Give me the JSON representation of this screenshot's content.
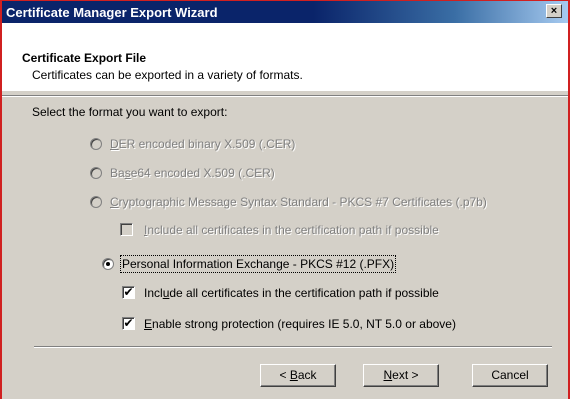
{
  "window": {
    "title": "Certificate Manager Export Wizard",
    "close_glyph": "×"
  },
  "header": {
    "title": "Certificate Export File",
    "subtitle": "Certificates can be exported in a variety of formats."
  },
  "prompt": "Select the format you want to export:",
  "options": [
    {
      "label_pre": "",
      "mnemonic": "D",
      "label_post": "ER encoded binary X.509 (.CER)",
      "selected": false,
      "enabled": false
    },
    {
      "label_pre": "Ba",
      "mnemonic": "s",
      "label_post": "e64 encoded X.509 (.CER)",
      "selected": false,
      "enabled": false
    },
    {
      "label_pre": "",
      "mnemonic": "C",
      "label_post": "ryptographic Message Syntax Standard - PKCS #7 Certificates (.p7b)",
      "selected": false,
      "enabled": false
    },
    {
      "label_pre": "Personal Information Exchange - PKCS #12 (.PFX)",
      "mnemonic": "",
      "label_post": "",
      "selected": true,
      "enabled": true
    }
  ],
  "checkboxes": [
    {
      "label_pre": "",
      "mnemonic": "I",
      "label_post": "nclude all certificates in the certification path if possible",
      "checked": false,
      "enabled": false
    },
    {
      "label_pre": "Incl",
      "mnemonic": "u",
      "label_post": "de all certificates in the certification path if possible",
      "checked": true,
      "enabled": true
    },
    {
      "label_pre": "",
      "mnemonic": "E",
      "label_post": "nable strong protection (requires IE 5.0, NT 5.0 or above)",
      "checked": true,
      "enabled": true
    }
  ],
  "check_glyph": "✔",
  "buttons": {
    "back": {
      "label_pre": "< ",
      "mnemonic": "B",
      "label_post": "ack"
    },
    "next": {
      "label_pre": "",
      "mnemonic": "N",
      "label_post": "ext >"
    },
    "cancel": {
      "label": "Cancel"
    }
  }
}
